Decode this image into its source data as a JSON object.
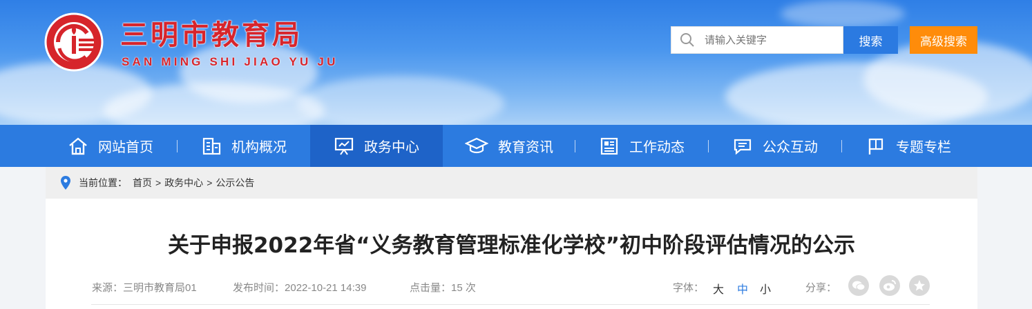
{
  "header": {
    "title": "三明市教育局",
    "subtitle": "SAN MING SHI JIAO YU JU",
    "logo_icon": "education-bureau-logo",
    "search": {
      "placeholder": "请输入关键字",
      "button_label": "搜索",
      "advanced_label": "高级搜索"
    },
    "colors": {
      "brand_red": "#d7252c",
      "accent_blue": "#2c7be0",
      "accent_orange": "#ff8c0a"
    }
  },
  "nav": {
    "items": [
      {
        "label": "网站首页",
        "icon": "home-icon"
      },
      {
        "label": "机构概况",
        "icon": "building-icon"
      },
      {
        "label": "政务中心",
        "icon": "presentation-icon"
      },
      {
        "label": "教育资讯",
        "icon": "graduation-cap-icon"
      },
      {
        "label": "工作动态",
        "icon": "newspaper-icon"
      },
      {
        "label": "公众互动",
        "icon": "chat-icon"
      },
      {
        "label": "专题专栏",
        "icon": "flag-icon"
      }
    ],
    "active_index": 2
  },
  "breadcrumb": {
    "prefix": "当前位置：",
    "items": [
      "首页",
      "政务中心",
      "公示公告"
    ],
    "separator": ">"
  },
  "article": {
    "title": "关于申报2022年省“义务教育管理标准化学校”初中阶段评估情况的公示",
    "source_label": "来源：",
    "source": "三明市教育局01",
    "time_label": "发布时间：",
    "time": "2022-10-21 14:39",
    "hits_label": "点击量：",
    "hits": "15 次",
    "font_label": "字体：",
    "font_sizes": [
      "大",
      "中",
      "小"
    ],
    "share_label": "分享：",
    "share_icons": [
      "wechat-icon",
      "weibo-icon",
      "favorite-star-icon"
    ]
  }
}
